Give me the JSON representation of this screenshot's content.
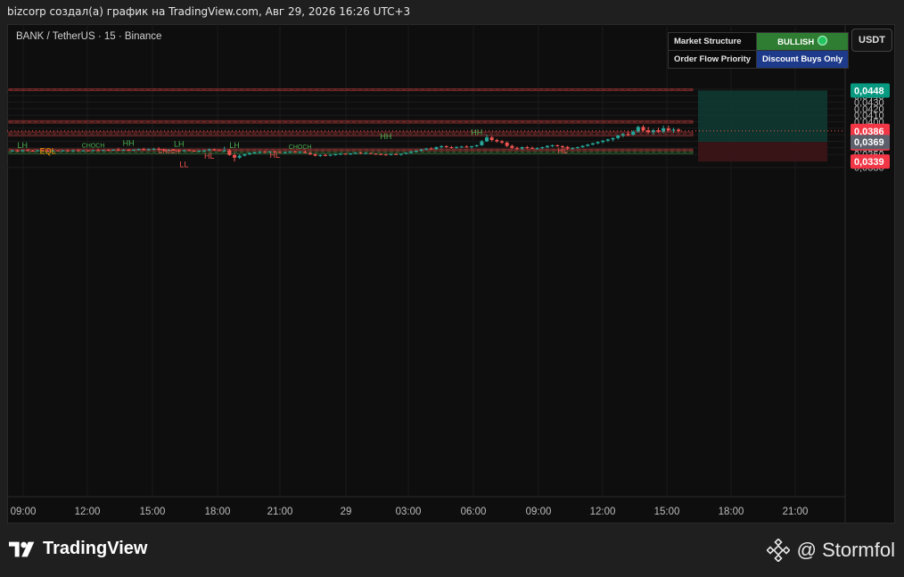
{
  "caption": "bizcorp создал(а) график на TradingView.com, Авг 29, 2026 16:26 UTC+3",
  "symbol_line": "BANK / TetherUS · 15 · Binance",
  "currency": "USDT",
  "status_table": {
    "rows": [
      {
        "label": "Market Structure",
        "value": "BULLISH",
        "color": "#2e7d32"
      },
      {
        "label": "Order Flow Priority",
        "value": "Discount Buys Only",
        "color": "#1e3a8a"
      }
    ]
  },
  "brand": "TradingView",
  "watermark": "@ Stormfol",
  "colors": {
    "up": "#26a69a",
    "down": "#ef5350",
    "structure_up": "#4caf50",
    "structure_down": "#ef5350",
    "target_zone": "#0f3b34",
    "stop_zone": "#3d1518"
  },
  "chart_data": {
    "type": "candlestick",
    "x_ticks": [
      "09:00",
      "12:00",
      "15:00",
      "18:00",
      "21:00",
      "29",
      "03:00",
      "06:00",
      "09:00",
      "12:00",
      "15:00",
      "18:00",
      "21:00"
    ],
    "y_ticks": [
      "0,0450",
      "0,0440",
      "0,0430",
      "0,0420",
      "0,0410",
      "0,0400",
      "0,0390",
      "0,0380",
      "0,0370",
      "0,0360",
      "0,0350",
      "0,0330"
    ],
    "ylim": [
      0.0325,
      0.0455
    ],
    "price_labels": [
      {
        "text": "0,0448",
        "value": 0.0448,
        "color": "#089981"
      },
      {
        "text": "0,0386",
        "sub": "03:12",
        "value": 0.0386,
        "color": "#f23645"
      },
      {
        "text": "0,0369",
        "value": 0.0369,
        "color": "#5d606b"
      },
      {
        "text": "0,0339",
        "value": 0.0339,
        "color": "#f23645"
      }
    ],
    "candles": [
      [
        0.03555,
        0.0357,
        0.03545,
        0.0356
      ],
      [
        0.0356,
        0.0357,
        0.0354,
        0.03548
      ],
      [
        0.03548,
        0.0357,
        0.03545,
        0.03565
      ],
      [
        0.03565,
        0.0358,
        0.0355,
        0.03555
      ],
      [
        0.03555,
        0.0357,
        0.0354,
        0.0355
      ],
      [
        0.0355,
        0.0357,
        0.03545,
        0.03562
      ],
      [
        0.03562,
        0.0357,
        0.0355,
        0.03555
      ],
      [
        0.03555,
        0.0357,
        0.03545,
        0.03552
      ],
      [
        0.03552,
        0.0357,
        0.03545,
        0.0356
      ],
      [
        0.0356,
        0.0357,
        0.0355,
        0.03555
      ],
      [
        0.03555,
        0.0357,
        0.03545,
        0.0356
      ],
      [
        0.0356,
        0.0357,
        0.0355,
        0.03554
      ],
      [
        0.03554,
        0.0357,
        0.03545,
        0.03562
      ],
      [
        0.03562,
        0.0358,
        0.0355,
        0.03555
      ],
      [
        0.03555,
        0.0357,
        0.03545,
        0.0356
      ],
      [
        0.0356,
        0.0357,
        0.0355,
        0.03556
      ],
      [
        0.03556,
        0.0357,
        0.03548,
        0.03565
      ],
      [
        0.03565,
        0.0358,
        0.03555,
        0.0356
      ],
      [
        0.0356,
        0.0357,
        0.0355,
        0.03568
      ],
      [
        0.03568,
        0.0358,
        0.03555,
        0.0356
      ],
      [
        0.0356,
        0.0358,
        0.03555,
        0.03572
      ],
      [
        0.03572,
        0.036,
        0.0356,
        0.03565
      ],
      [
        0.03565,
        0.0358,
        0.03555,
        0.0357
      ],
      [
        0.0357,
        0.0358,
        0.0356,
        0.03562
      ],
      [
        0.03562,
        0.0358,
        0.03555,
        0.0357
      ],
      [
        0.0357,
        0.0359,
        0.0356,
        0.0358
      ],
      [
        0.0358,
        0.036,
        0.03565,
        0.03575
      ],
      [
        0.03575,
        0.0359,
        0.0356,
        0.03578
      ],
      [
        0.03578,
        0.036,
        0.03565,
        0.03585
      ],
      [
        0.03585,
        0.0361,
        0.0357,
        0.03575
      ],
      [
        0.03575,
        0.0359,
        0.03555,
        0.0356
      ],
      [
        0.0356,
        0.0358,
        0.0355,
        0.0357
      ],
      [
        0.0357,
        0.0358,
        0.03555,
        0.03562
      ],
      [
        0.03562,
        0.0357,
        0.03545,
        0.03555
      ],
      [
        0.03555,
        0.0357,
        0.0354,
        0.03565
      ],
      [
        0.03565,
        0.0358,
        0.0355,
        0.03555
      ],
      [
        0.03555,
        0.0357,
        0.0354,
        0.03548
      ],
      [
        0.03548,
        0.0356,
        0.03535,
        0.03555
      ],
      [
        0.03555,
        0.0357,
        0.03545,
        0.0356
      ],
      [
        0.0356,
        0.0359,
        0.0355,
        0.03575
      ],
      [
        0.03575,
        0.0359,
        0.0356,
        0.03565
      ],
      [
        0.03565,
        0.0358,
        0.0355,
        0.03555
      ],
      [
        0.03555,
        0.0362,
        0.03545,
        0.0356
      ],
      [
        0.0356,
        0.0358,
        0.0348,
        0.0349
      ],
      [
        0.0349,
        0.0352,
        0.0339,
        0.0345
      ],
      [
        0.0345,
        0.035,
        0.0343,
        0.0348
      ],
      [
        0.0348,
        0.0351,
        0.0347,
        0.035
      ],
      [
        0.035,
        0.0353,
        0.0349,
        0.0352
      ],
      [
        0.0352,
        0.0354,
        0.03505,
        0.0353
      ],
      [
        0.0353,
        0.0355,
        0.0351,
        0.0354
      ],
      [
        0.0354,
        0.0356,
        0.0352,
        0.03532
      ],
      [
        0.03532,
        0.0355,
        0.0352,
        0.03545
      ],
      [
        0.03545,
        0.0356,
        0.0353,
        0.03538
      ],
      [
        0.03538,
        0.0355,
        0.0352,
        0.03525
      ],
      [
        0.03525,
        0.0354,
        0.0351,
        0.03535
      ],
      [
        0.03535,
        0.0355,
        0.0352,
        0.03542
      ],
      [
        0.03542,
        0.0356,
        0.03525,
        0.0353
      ],
      [
        0.0353,
        0.0355,
        0.0352,
        0.0354
      ],
      [
        0.0354,
        0.0356,
        0.03525,
        0.0352
      ],
      [
        0.0352,
        0.0354,
        0.0349,
        0.035
      ],
      [
        0.035,
        0.0352,
        0.0347,
        0.0348
      ],
      [
        0.0348,
        0.035,
        0.0346,
        0.0349
      ],
      [
        0.0349,
        0.0351,
        0.0347,
        0.03485
      ],
      [
        0.03485,
        0.035,
        0.0347,
        0.03495
      ],
      [
        0.03495,
        0.0351,
        0.0348,
        0.03502
      ],
      [
        0.03502,
        0.0352,
        0.0349,
        0.0351
      ],
      [
        0.0351,
        0.0352,
        0.03495,
        0.035
      ],
      [
        0.035,
        0.0352,
        0.0349,
        0.03515
      ],
      [
        0.03515,
        0.0353,
        0.035,
        0.03525
      ],
      [
        0.03525,
        0.0354,
        0.03505,
        0.03512
      ],
      [
        0.03512,
        0.0353,
        0.035,
        0.0352
      ],
      [
        0.0352,
        0.0353,
        0.03505,
        0.0351
      ],
      [
        0.0351,
        0.0352,
        0.03495,
        0.03505
      ],
      [
        0.03505,
        0.0352,
        0.0349,
        0.03498
      ],
      [
        0.03498,
        0.0351,
        0.03485,
        0.03495
      ],
      [
        0.03495,
        0.0351,
        0.03485,
        0.03505
      ],
      [
        0.03505,
        0.0352,
        0.0349,
        0.03495
      ],
      [
        0.03495,
        0.0351,
        0.0348,
        0.0351
      ],
      [
        0.0351,
        0.0353,
        0.035,
        0.03525
      ],
      [
        0.03525,
        0.0355,
        0.0351,
        0.03545
      ],
      [
        0.03545,
        0.0356,
        0.0353,
        0.03555
      ],
      [
        0.03555,
        0.0358,
        0.03545,
        0.03575
      ],
      [
        0.03575,
        0.036,
        0.0356,
        0.0359
      ],
      [
        0.0359,
        0.0361,
        0.0357,
        0.0358
      ],
      [
        0.0358,
        0.0362,
        0.0357,
        0.0361
      ],
      [
        0.0361,
        0.0364,
        0.0359,
        0.03625
      ],
      [
        0.03625,
        0.0364,
        0.036,
        0.0361
      ],
      [
        0.0361,
        0.0363,
        0.0359,
        0.036
      ],
      [
        0.036,
        0.0362,
        0.03585,
        0.03615
      ],
      [
        0.03615,
        0.0363,
        0.036,
        0.0362
      ],
      [
        0.0362,
        0.0364,
        0.036,
        0.0361
      ],
      [
        0.0361,
        0.0363,
        0.0359,
        0.03625
      ],
      [
        0.03625,
        0.0365,
        0.0361,
        0.0364
      ],
      [
        0.0364,
        0.0372,
        0.0363,
        0.037
      ],
      [
        0.037,
        0.038,
        0.0369,
        0.0376
      ],
      [
        0.0376,
        0.0378,
        0.037,
        0.0372
      ],
      [
        0.0372,
        0.0374,
        0.0368,
        0.037
      ],
      [
        0.037,
        0.0372,
        0.0366,
        0.0368
      ],
      [
        0.0368,
        0.037,
        0.0361,
        0.0363
      ],
      [
        0.0363,
        0.0365,
        0.0358,
        0.036
      ],
      [
        0.036,
        0.0362,
        0.0357,
        0.0359
      ],
      [
        0.0359,
        0.0362,
        0.0357,
        0.0361
      ],
      [
        0.0361,
        0.0363,
        0.03585,
        0.036
      ],
      [
        0.036,
        0.0362,
        0.0358,
        0.0359
      ],
      [
        0.0359,
        0.0361,
        0.0357,
        0.03595
      ],
      [
        0.03595,
        0.0362,
        0.0358,
        0.0361
      ],
      [
        0.0361,
        0.0364,
        0.03595,
        0.0363
      ],
      [
        0.0363,
        0.0365,
        0.0361,
        0.0364
      ],
      [
        0.0364,
        0.0365,
        0.03615,
        0.03625
      ],
      [
        0.03625,
        0.0364,
        0.036,
        0.03615
      ],
      [
        0.03615,
        0.0363,
        0.0357,
        0.0359
      ],
      [
        0.0359,
        0.0361,
        0.03575,
        0.036
      ],
      [
        0.036,
        0.0362,
        0.03585,
        0.0361
      ],
      [
        0.0361,
        0.0364,
        0.036,
        0.0363
      ],
      [
        0.0363,
        0.0366,
        0.0362,
        0.0365
      ],
      [
        0.0365,
        0.0368,
        0.0364,
        0.0367
      ],
      [
        0.0367,
        0.037,
        0.03655,
        0.0369
      ],
      [
        0.0369,
        0.0372,
        0.0367,
        0.0371
      ],
      [
        0.0371,
        0.0374,
        0.0369,
        0.0373
      ],
      [
        0.0373,
        0.0376,
        0.037,
        0.0375
      ],
      [
        0.0375,
        0.038,
        0.0373,
        0.0379
      ],
      [
        0.0379,
        0.0383,
        0.0376,
        0.0381
      ],
      [
        0.0381,
        0.0385,
        0.0378,
        0.038
      ],
      [
        0.038,
        0.0387,
        0.0379,
        0.0385
      ],
      [
        0.0385,
        0.0394,
        0.0383,
        0.0392
      ],
      [
        0.0392,
        0.0395,
        0.0385,
        0.0387
      ],
      [
        0.0387,
        0.0392,
        0.0382,
        0.0384
      ],
      [
        0.0384,
        0.0389,
        0.038,
        0.0387
      ],
      [
        0.0387,
        0.0391,
        0.0383,
        0.0385
      ],
      [
        0.0385,
        0.0394,
        0.0382,
        0.039
      ],
      [
        0.039,
        0.0394,
        0.0384,
        0.0387
      ],
      [
        0.0387,
        0.0391,
        0.0383,
        0.0388
      ],
      [
        0.0388,
        0.039,
        0.0384,
        0.0386
      ]
    ],
    "structure_labels": [
      {
        "text": "LH",
        "i": 2,
        "y": 0.036,
        "color": "#4caf50"
      },
      {
        "text": "HH",
        "i": 23,
        "y": 0.0363,
        "color": "#4caf50"
      },
      {
        "text": "LH",
        "i": 33,
        "y": 0.0362,
        "color": "#4caf50"
      },
      {
        "text": "LH",
        "i": 44,
        "y": 0.03595,
        "color": "#4caf50"
      },
      {
        "text": "HH",
        "i": 74,
        "y": 0.03735,
        "color": "#4caf50"
      },
      {
        "text": "HH",
        "i": 92,
        "y": 0.03795,
        "color": "#4caf50"
      },
      {
        "text": "EQL",
        "i": 7,
        "y": 0.03505,
        "color": "#ff9800"
      },
      {
        "text": "LL",
        "i": 34,
        "y": 0.033,
        "color": "#ef5350"
      },
      {
        "text": "HL",
        "i": 39,
        "y": 0.03435,
        "color": "#ef5350"
      },
      {
        "text": "HL",
        "i": 52,
        "y": 0.0345,
        "color": "#ef5350"
      },
      {
        "text": "HL",
        "i": 109,
        "y": 0.03515,
        "color": "#ef5350"
      },
      {
        "text": "CHOCH",
        "i": 16,
        "y": 0.03602,
        "color": "#4caf50"
      },
      {
        "text": "CHOCH",
        "i": 57,
        "y": 0.03583,
        "color": "#4caf50"
      },
      {
        "text": "CHoCH",
        "i": 31,
        "y": 0.03515,
        "color": "#ef5350"
      }
    ],
    "zones": [
      {
        "kind": "supply",
        "from": 0.04505,
        "to": 0.04488
      },
      {
        "kind": "supply",
        "from": 0.04018,
        "to": 0.0398
      },
      {
        "kind": "supply",
        "from": 0.03843,
        "to": 0.03785
      },
      {
        "kind": "demand",
        "from": 0.03558,
        "to": 0.03512
      },
      {
        "kind": "supply",
        "from": 0.03582,
        "to": 0.0356
      }
    ],
    "trade_box": {
      "entry": 0.0369,
      "target": 0.0448,
      "stop": 0.0339
    }
  }
}
